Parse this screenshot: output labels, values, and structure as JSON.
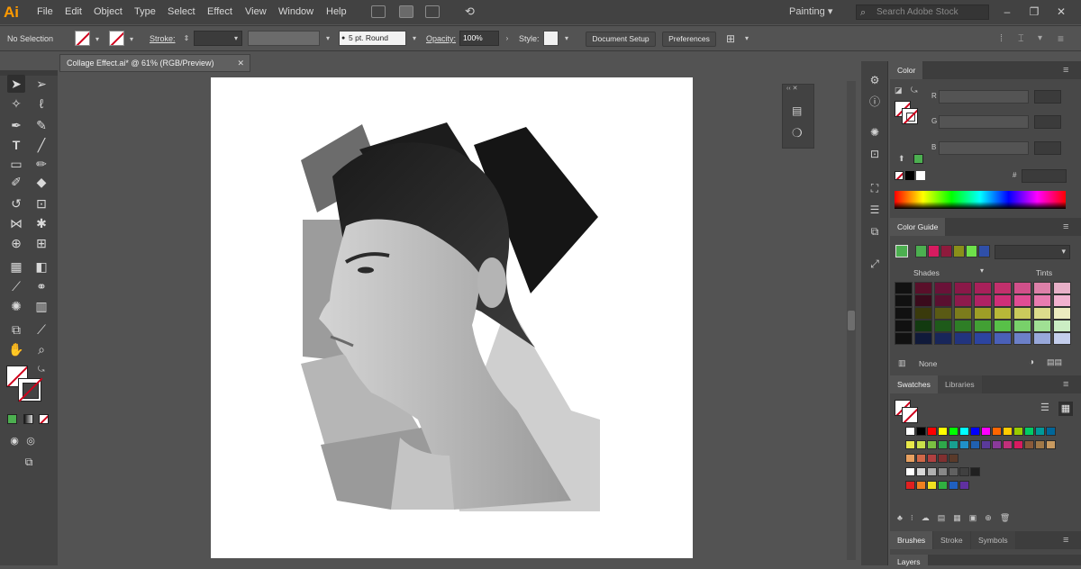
{
  "app": {
    "logo": "Ai"
  },
  "menu": [
    "File",
    "Edit",
    "Object",
    "Type",
    "Select",
    "Effect",
    "View",
    "Window",
    "Help"
  ],
  "workspace": {
    "label": "Painting"
  },
  "search": {
    "placeholder": "Search Adobe Stock"
  },
  "control": {
    "selection": "No Selection",
    "stroke_label": "Stroke:",
    "brush_label": "5 pt. Round",
    "opacity_label": "Opacity:",
    "opacity_value": "100%",
    "style_label": "Style:",
    "document_setup": "Document Setup",
    "preferences": "Preferences"
  },
  "document_tab": {
    "title": "Collage Effect.ai* @ 61% (RGB/Preview)"
  },
  "panels": {
    "color": {
      "title": "Color",
      "channels": [
        "R",
        "G",
        "B"
      ]
    },
    "color_guide": {
      "title": "Color Guide",
      "shades": "Shades",
      "tints": "Tints",
      "none": "None"
    },
    "swatches": {
      "title": "Swatches",
      "libraries": "Libraries"
    },
    "bottom_tabs": [
      "Brushes",
      "Stroke",
      "Symbols"
    ],
    "layers": "Layers"
  },
  "colors": {
    "accent": "#ff9a00",
    "fill_green": "#4caf50"
  },
  "guide_base": [
    "#4caf50",
    "#d81b60",
    "#8e1a3c",
    "#8a8f1a",
    "#6ee04a",
    "#2f4fa8"
  ],
  "guide_grid": [
    [
      "#111",
      "#5a0f2a",
      "#6a1238",
      "#8a1848",
      "#a8205a",
      "#c2306c",
      "#d0508a",
      "#dc80a8",
      "#e8b0c8"
    ],
    [
      "#111",
      "#3a0b1c",
      "#5a1030",
      "#8e1a4c",
      "#b02264",
      "#d02e78",
      "#e04c94",
      "#e87cb0",
      "#f2b2d0"
    ],
    [
      "#111",
      "#3a3a0c",
      "#5a5a14",
      "#7c7c1c",
      "#9e9e26",
      "#b8b838",
      "#caca5c",
      "#dcdc8c",
      "#ececc0"
    ],
    [
      "#111",
      "#123a10",
      "#1e5a1a",
      "#2e7e26",
      "#42a034",
      "#58c048",
      "#78d06a",
      "#a0e094",
      "#cbeec4"
    ],
    [
      "#111",
      "#101a3a",
      "#18265a",
      "#22347e",
      "#2c44a0",
      "#4a60b8",
      "#6c80c8",
      "#98a8da",
      "#c4ceec"
    ]
  ],
  "swatch_rows": [
    [
      "#ffffff",
      "#000000",
      "#ff0000",
      "#ffff00",
      "#00ff00",
      "#00ffff",
      "#0000ff",
      "#ff00ff",
      "#ff6600",
      "#ffcc00",
      "#99cc00",
      "#00cc66",
      "#009999",
      "#006699"
    ],
    [
      "#e8e84a",
      "#c8e04a",
      "#7ac142",
      "#2ea84a",
      "#18a090",
      "#2090c8",
      "#2060b0",
      "#5a3a9a",
      "#8a3a9a",
      "#c0307a",
      "#d81b60",
      "#8a5a3a",
      "#a07848",
      "#c89a60"
    ],
    [
      "#e8a060",
      "#d06848",
      "#b04040",
      "#803030",
      "#5a3a2a"
    ],
    [
      "#ffffff",
      "#d8d8d8",
      "#b0b0b0",
      "#888888",
      "#606060",
      "#404040",
      "#202020"
    ],
    [
      "#e02020",
      "#f08020",
      "#f0e020",
      "#30b040",
      "#2060c0",
      "#6030a0"
    ]
  ]
}
